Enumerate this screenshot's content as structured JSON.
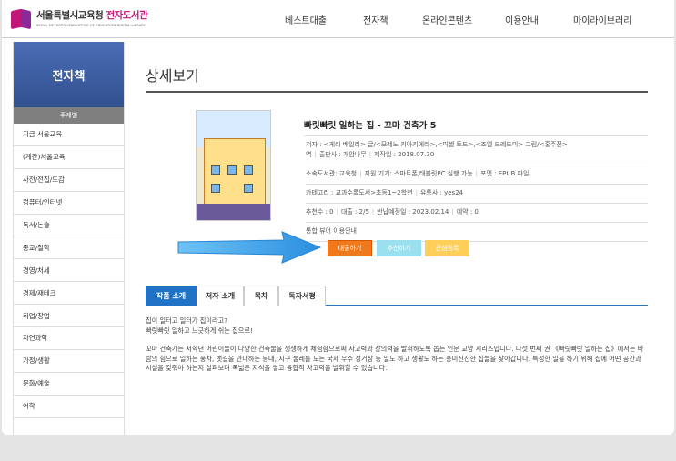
{
  "header": {
    "logo_main_prefix": "서울특별시교육청 ",
    "logo_main_accent": "전자도서관",
    "logo_sub": "SEOUL METROPOLITAN OFFICE OF EDUCATION DIGITAL LIBRARY",
    "nav": [
      "베스트대출",
      "전자책",
      "온라인콘텐츠",
      "이용안내",
      "마이라이브러리"
    ]
  },
  "sidebar": {
    "title": "전자책",
    "section_header": "주제별",
    "items": [
      "지금 서울교육",
      "(계간)서울교육",
      "사전/전집/도감",
      "컴퓨터/인터넷",
      "독서/논술",
      "종교/철학",
      "경영/처세",
      "경제/재테크",
      "취업/창업",
      "자연과학",
      "가정/생활",
      "문화/예술",
      "어학"
    ]
  },
  "main": {
    "page_title": "상세보기",
    "book": {
      "title": "빠릿빠릿 일하는 집 - 꼬마 건축가 5",
      "authors_label": "저자 : ",
      "authors": "<게리 베일리> 글/<모레노 키아키에라>,<미셸 토드>,<조엘 드레드미> 그림/<홍주진>",
      "translator_line": "역",
      "publisher": "출판사 : 개암나무",
      "pub_date": "제작일 : 2018.07.30",
      "library": "소속도서관: 교육청",
      "devices": "지원 기기: 스마트폰,태블릿PC 실행 가능",
      "format": "포맷 : EPUB 파일",
      "category": "카테고리 : 교과수록도서>초등1~2학년",
      "distributor": "유통사 : yes24",
      "recommend": "추천수 : 0",
      "loan": "대출 : 2/5",
      "return_date": "반납예정일 : 2023.02.14",
      "reserve": "예약 : 0",
      "viewer": "통합 뷰어 이용안내"
    },
    "buttons": [
      "대출하기",
      "추천하기",
      "관심등록"
    ],
    "tabs": [
      "작품 소개",
      "저자 소개",
      "목차",
      "독자서평"
    ],
    "description": {
      "line1": "집이 일터고 일터가 집이라고?",
      "line2": "빠릿빠릿 일하고 느긋하게 쉬는 집으로!",
      "para": "꼬마 건축가는 저학년 어린이들이 다양한 건축물을 생생하게 체험함으로써 사고력과 창의력을 발휘하도록 돕는 인문 교양 시리즈입니다. 다섯 번째 권 《빠릿빠릿 일하는 집》에서는 바람의 힘으로 일하는 풍차, 뱃길을 안내하는 등대, 지구 둘레를 도는 국제 우주 정거장 등 일도 하고 생활도 하는 흥미진진한 집들을 찾아갑니다. 특정한 일을 하기 위해 집에 어떤 공간과 시설을 갖춰야 하는지 살펴보며 폭넓은 지식을 쌓고 융합적 사고력을 발휘할 수 있습니다."
    }
  },
  "colors": {
    "sidebar_title_bg": "#3a5a9e",
    "active_tab": "#1f72c6",
    "loan_button": "#f0791c",
    "recommend_button": "#9ae0ee",
    "wish_button": "#ffcf5a",
    "arrow": "#3aa0e8",
    "logo_accent": "#c2187a"
  },
  "icons": {
    "logo": "library-book-logo-icon",
    "annotation_arrow": "right-arrow-icon"
  }
}
